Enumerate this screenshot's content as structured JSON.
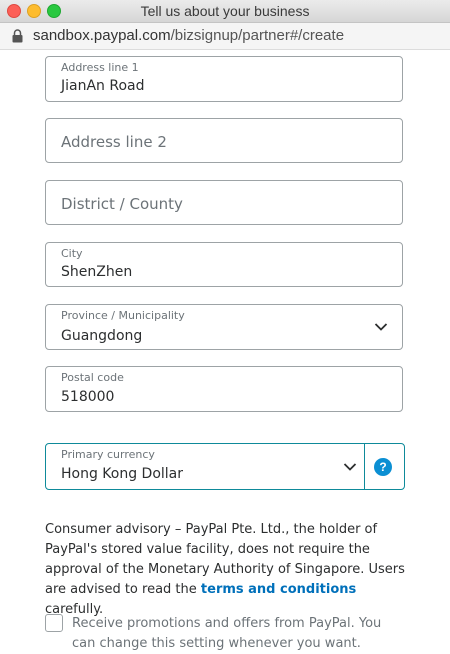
{
  "window": {
    "title": "Tell us about your business"
  },
  "urlbar": {
    "domain": "sandbox.paypal.com",
    "path": "/bizsignup/partner#/create"
  },
  "form": {
    "address1": {
      "label": "Address line 1",
      "value": "JianAn Road"
    },
    "address2": {
      "placeholder": "Address line 2"
    },
    "district": {
      "placeholder": "District / County"
    },
    "city": {
      "label": "City",
      "value": "ShenZhen"
    },
    "province": {
      "label": "Province / Municipality",
      "value": "Guangdong"
    },
    "postal": {
      "label": "Postal code",
      "value": "518000"
    },
    "currency": {
      "label": "Primary currency",
      "value": "Hong Kong Dollar"
    }
  },
  "help_icon": "?",
  "advisory": {
    "text": "Consumer advisory – PayPal Pte. Ltd., the holder of PayPal's stored value facility, does not require the approval of the Monetary Authority of Singapore. Users are advised to read the ",
    "link": "terms and conditions",
    "suffix": " carefully."
  },
  "promo": {
    "text": "Receive promotions and offers from PayPal. You can change this setting whenever you want."
  },
  "colors": {
    "accent": "#0e8a9a",
    "link": "#0070ba",
    "help_bg": "#0b8fd3"
  }
}
